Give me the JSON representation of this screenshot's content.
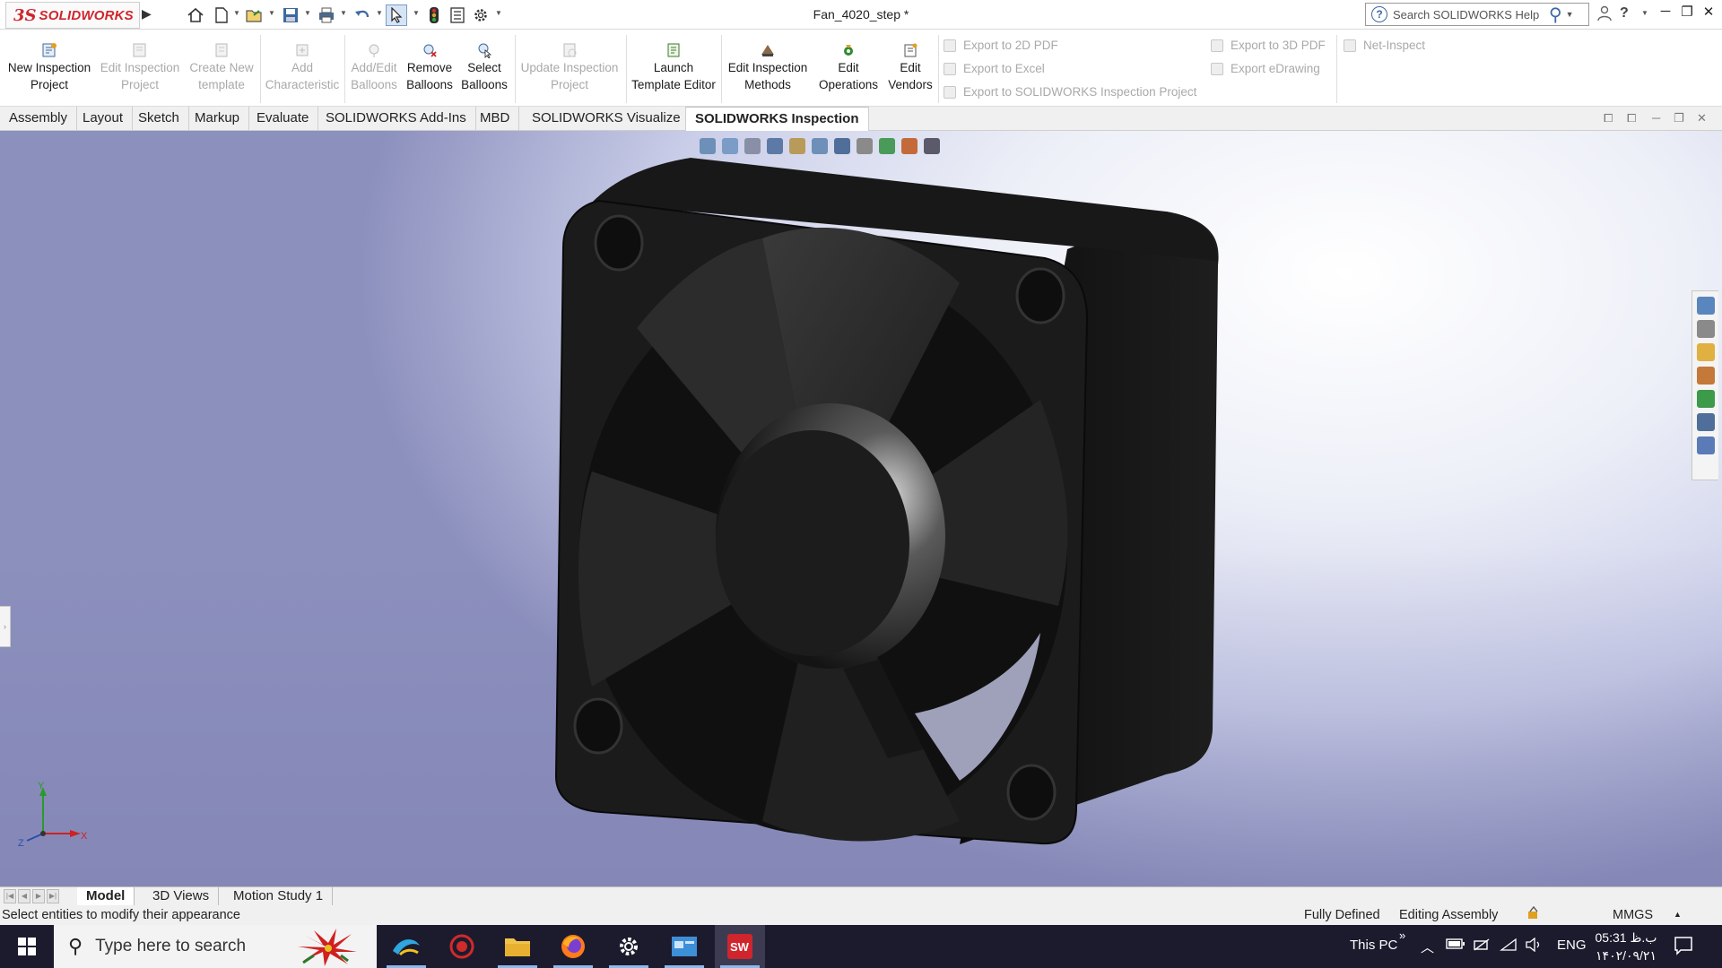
{
  "app": {
    "logo_ds": "3S",
    "logo_word": "SOLIDWORKS",
    "document_title": "Fan_4020_step *"
  },
  "search": {
    "placeholder": "Search SOLIDWORKS Help"
  },
  "ribbon": {
    "new_inspection_project": [
      "New Inspection",
      "Project"
    ],
    "edit_inspection_project": [
      "Edit Inspection",
      "Project"
    ],
    "create_new_template": [
      "Create New",
      "template"
    ],
    "add_characteristic": [
      "Add",
      "Characteristic"
    ],
    "add_edit_balloons": [
      "Add/Edit",
      "Balloons"
    ],
    "remove_balloons": [
      "Remove",
      "Balloons"
    ],
    "select_balloons": [
      "Select",
      "Balloons"
    ],
    "update_inspection_project": [
      "Update Inspection",
      "Project"
    ],
    "launch_template_editor": [
      "Launch",
      "Template Editor"
    ],
    "edit_inspection_methods": [
      "Edit Inspection",
      "Methods"
    ],
    "edit_operations": [
      "Edit",
      "Operations"
    ],
    "edit_vendors": [
      "Edit",
      "Vendors"
    ],
    "export_2d_pdf": "Export to 2D PDF",
    "export_excel": "Export to Excel",
    "export_sw_inspection_project": "Export to SOLIDWORKS Inspection Project",
    "export_3d_pdf": "Export to 3D PDF",
    "export_edrawing": "Export eDrawing",
    "net_inspect": "Net-Inspect"
  },
  "tabs": [
    "Assembly",
    "Layout",
    "Sketch",
    "Markup",
    "Evaluate",
    "SOLIDWORKS Add-Ins",
    "MBD",
    "SOLIDWORKS Visualize",
    "SOLIDWORKS Inspection"
  ],
  "active_tab": "SOLIDWORKS Inspection",
  "triad": {
    "x": "X",
    "y": "Y",
    "z": "Z"
  },
  "bottom_tabs": [
    "Model",
    "3D Views",
    "Motion Study 1"
  ],
  "status": {
    "message": "Select entities to modify their appearance",
    "fully_defined": "Fully Defined",
    "editing": "Editing Assembly",
    "units": "MMGS",
    "units_arrow": "▲"
  },
  "taskbar": {
    "search_placeholder": "Type here to search",
    "this_pc": "This PC",
    "chevron": "»",
    "language": "ENG",
    "time": "05:31 ب.ظ",
    "date": "۱۴۰۲/۰۹/۲۱"
  },
  "colors": {
    "brand_red": "#d0252d",
    "taskbar": "#1c1b2e",
    "fan_body": "#1a1a1a"
  },
  "icons": {
    "title_bar": [
      "home-icon",
      "new-document-icon",
      "open-folder-icon",
      "save-icon",
      "print-icon",
      "undo-icon",
      "select-arrow-icon",
      "traffic-light-icon",
      "file-properties-icon",
      "options-gear-icon"
    ],
    "window": [
      "user-icon",
      "help-question-icon",
      "minimize-icon",
      "restore-icon",
      "close-icon"
    ]
  }
}
